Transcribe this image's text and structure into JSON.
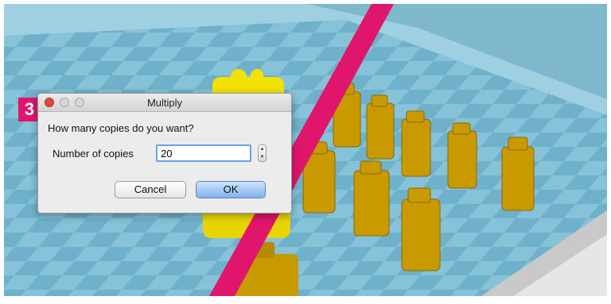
{
  "step_badge": "3",
  "dialog": {
    "title": "Multiply",
    "question": "How many copies do you want?",
    "field_label": "Number of copies",
    "copies_value": "20",
    "cancel_label": "Cancel",
    "ok_label": "OK"
  },
  "icons": {
    "close": "close-icon",
    "minimize": "minimize-icon",
    "zoom": "zoom-icon",
    "stepper_up": "chevron-up-icon",
    "stepper_down": "chevron-down-icon"
  },
  "colors": {
    "accent": "#e0156c",
    "build_plate": "#8ec8dd",
    "model_selected": "#f2e200",
    "model": "#c99a00"
  }
}
